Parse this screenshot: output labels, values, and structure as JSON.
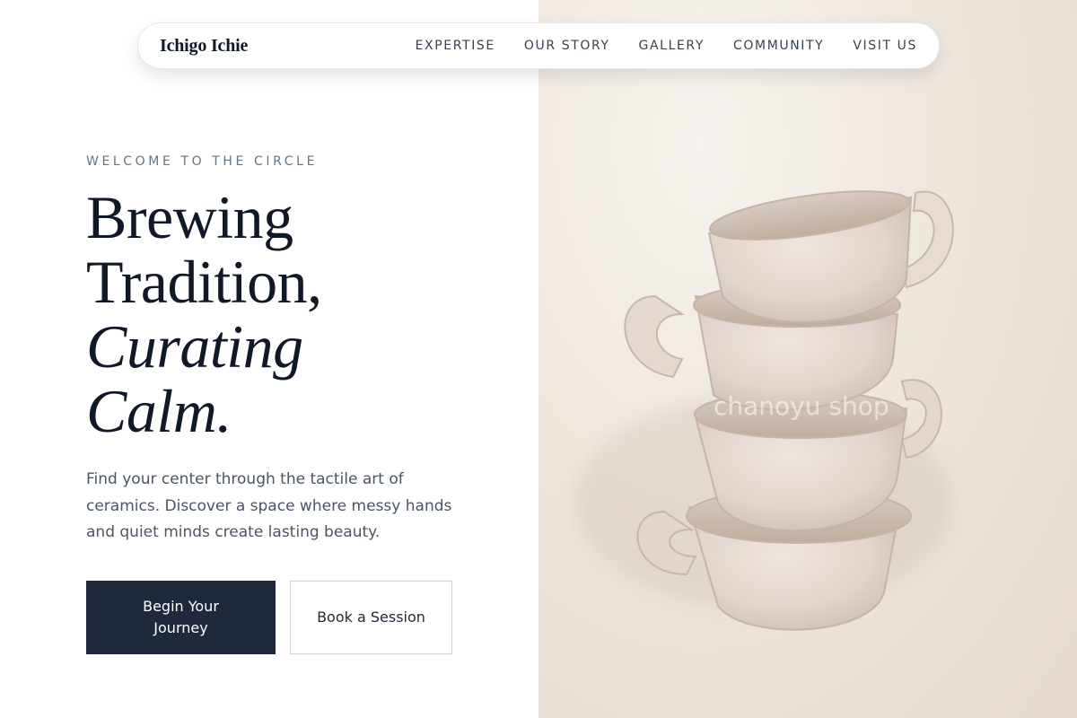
{
  "brand": {
    "name": "Ichigo Ichie"
  },
  "nav": {
    "items": [
      {
        "label": "EXPERTISE"
      },
      {
        "label": "OUR STORY"
      },
      {
        "label": "GALLERY"
      },
      {
        "label": "COMMUNITY"
      },
      {
        "label": "VISIT US"
      }
    ]
  },
  "hero": {
    "eyebrow": "WELCOME TO THE CIRCLE",
    "headline": {
      "line1": "Brewing",
      "line2": "Tradition,",
      "line3": "Curating",
      "line4": "Calm."
    },
    "description": "Find your center through the tactile art of ceramics. Discover a space where messy hands and quiet minds create lasting beauty.",
    "primary_cta": "Begin Your Journey",
    "secondary_cta": "Book a Session",
    "image_watermark": "chanoyu shop",
    "image_alt_icon": "stacked-clay-cups"
  },
  "colors": {
    "primary": "#1e293b",
    "text": "#111827",
    "muted": "#64748b",
    "background": "#ffffff",
    "image_bg": "#efe8df",
    "clay": "#e2d6cd"
  }
}
